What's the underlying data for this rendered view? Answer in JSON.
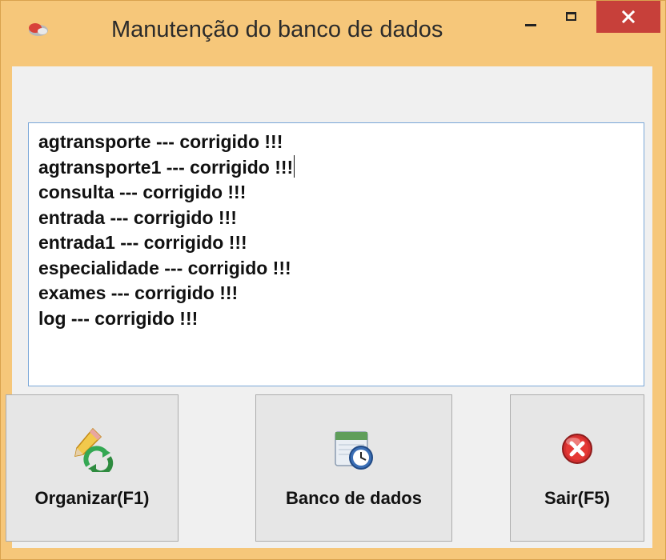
{
  "window": {
    "title": "Manutenção do banco de dados"
  },
  "log": {
    "lines": [
      "agtransporte --- corrigido !!!",
      "agtransporte1 --- corrigido !!!",
      "consulta --- corrigido !!!",
      "entrada --- corrigido !!!",
      "entrada1 --- corrigido !!!",
      "especialidade --- corrigido !!!",
      "exames --- corrigido !!!",
      "log --- corrigido !!!"
    ]
  },
  "buttons": {
    "organizar": {
      "label": "Organizar(F1)",
      "icon": "pencil-refresh-icon"
    },
    "banco": {
      "label": "Banco de dados",
      "icon": "calendar-clock-icon"
    },
    "sair": {
      "label": "Sair(F5)",
      "icon": "red-x-circle-icon"
    }
  },
  "colors": {
    "frame": "#f6c77a",
    "close_button": "#c7403a",
    "client": "#f0f0f0",
    "textbox_border": "#7aa7d8"
  }
}
